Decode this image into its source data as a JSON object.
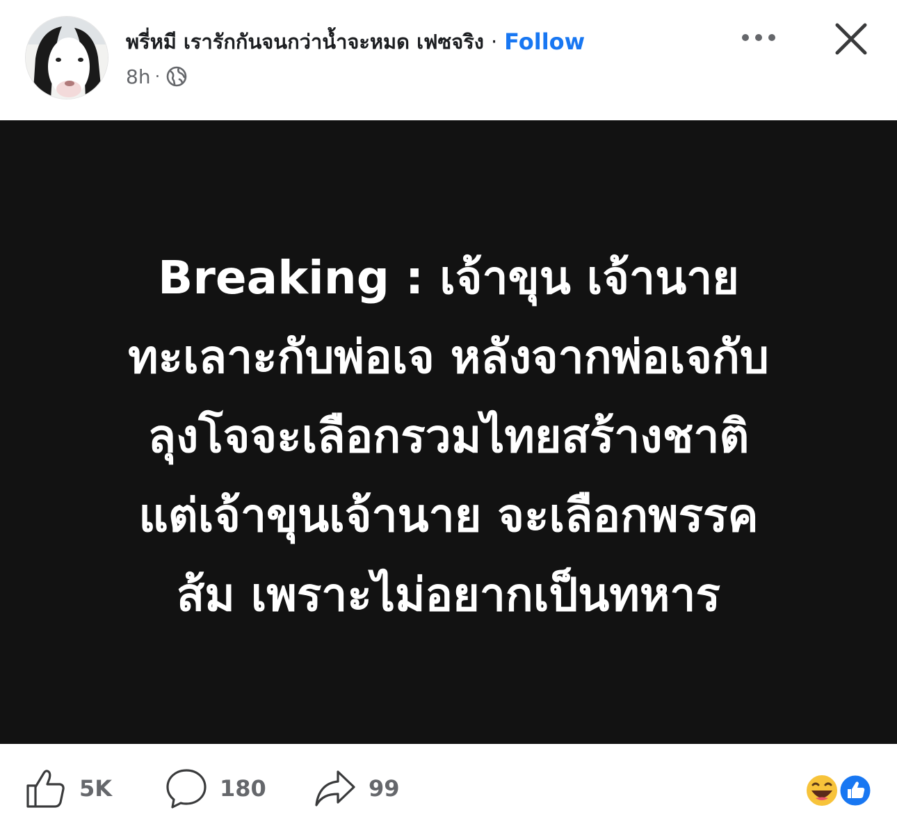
{
  "post": {
    "author_name": "พรี่หมี เรารักกันจนกว่าน้ำจะหมด เฟซจริง",
    "separator": "·",
    "follow_label": "Follow",
    "time": "8h",
    "meta_separator": "·",
    "audience_icon": "globe-icon",
    "more_icon": "more-options-icon",
    "close_icon": "close-icon",
    "text_lines": [
      "Breaking : เจ้าขุน เจ้านาย",
      "ทะเลาะกับพ่อเจ หลังจากพ่อเจกับ",
      "ลุงโจจะเลือกรวมไทยสร้างชาติ",
      "แต่เจ้าขุนเจ้านาย จะเลือกพรรค",
      "ส้ม เพราะไม่อยากเป็นทหาร"
    ]
  },
  "footer": {
    "likes": "5K",
    "comments": "180",
    "shares": "99",
    "reaction_icons": [
      "haha-reaction-icon",
      "like-reaction-icon"
    ]
  },
  "colors": {
    "follow": "#1877f2",
    "media_background": "#121212",
    "meta_text": "#65676b",
    "like_reaction": "#1877f2",
    "haha_reaction": "#f7c33a"
  }
}
